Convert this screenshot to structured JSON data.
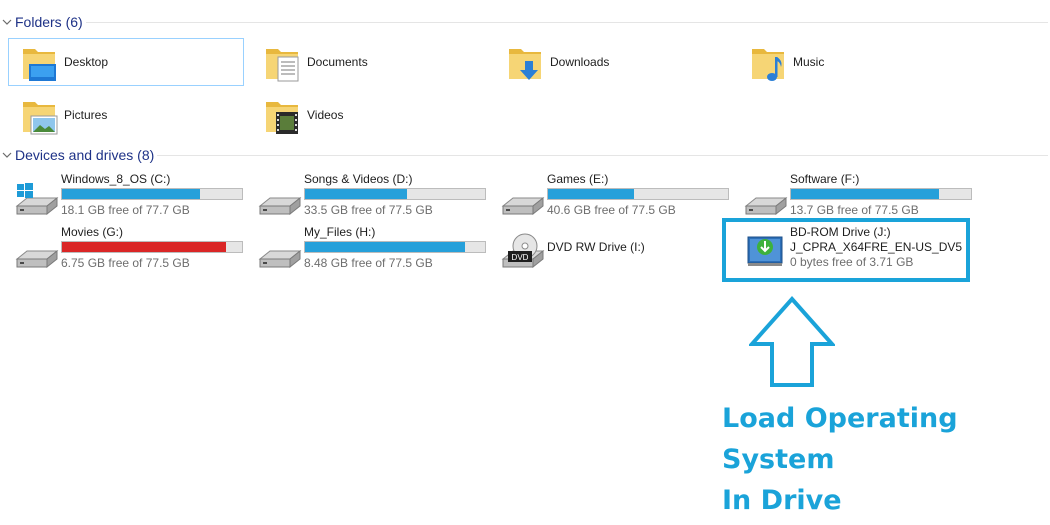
{
  "folders_group": {
    "header": "Folders (6)"
  },
  "folders": [
    {
      "label": "Desktop",
      "icon": "desktop-folder-icon",
      "selected": true
    },
    {
      "label": "Documents",
      "icon": "documents-folder-icon"
    },
    {
      "label": "Downloads",
      "icon": "downloads-folder-icon"
    },
    {
      "label": "Music",
      "icon": "music-folder-icon"
    },
    {
      "label": "Pictures",
      "icon": "pictures-folder-icon"
    },
    {
      "label": "Videos",
      "icon": "videos-folder-icon"
    }
  ],
  "drives_group": {
    "header": "Devices and drives (8)"
  },
  "drives": [
    {
      "name": "Windows_8_OS (C:)",
      "free": "18.1 GB free of 77.7 GB",
      "used_fraction": 0.767,
      "icon": "windows-drive-icon"
    },
    {
      "name": "Songs & Videos (D:)",
      "free": "33.5 GB free of 77.5 GB",
      "used_fraction": 0.568,
      "icon": "hard-drive-icon"
    },
    {
      "name": "Games (E:)",
      "free": "40.6 GB free of 77.5 GB",
      "used_fraction": 0.476,
      "icon": "hard-drive-icon"
    },
    {
      "name": "Software (F:)",
      "free": "13.7 GB free of 77.5 GB",
      "used_fraction": 0.823,
      "icon": "hard-drive-icon"
    },
    {
      "name": "Movies (G:)",
      "free": "6.75 GB free of 77.5 GB",
      "used_fraction": 0.913,
      "icon": "hard-drive-icon",
      "bar_color": "#da2626"
    },
    {
      "name": "My_Files (H:)",
      "free": "8.48 GB free of 77.5 GB",
      "used_fraction": 0.891,
      "icon": "hard-drive-icon"
    },
    {
      "name": "DVD RW Drive (I:)",
      "icon": "dvd-drive-icon",
      "dvd_badge": "DVD"
    },
    {
      "name": "BD-ROM Drive (J:)",
      "name2": "J_CPRA_X64FRE_EN-US_DV5",
      "free": "0 bytes free of 3.71 GB",
      "icon": "bd-rom-install-icon"
    }
  ],
  "annotation": {
    "line1": "Load Operating System",
    "line2": "In Drive",
    "color": "#1aa3d9"
  },
  "colors": {
    "bar_normal": "#26a0da",
    "bar_full": "#da2626",
    "header_text": "#1e3287"
  }
}
